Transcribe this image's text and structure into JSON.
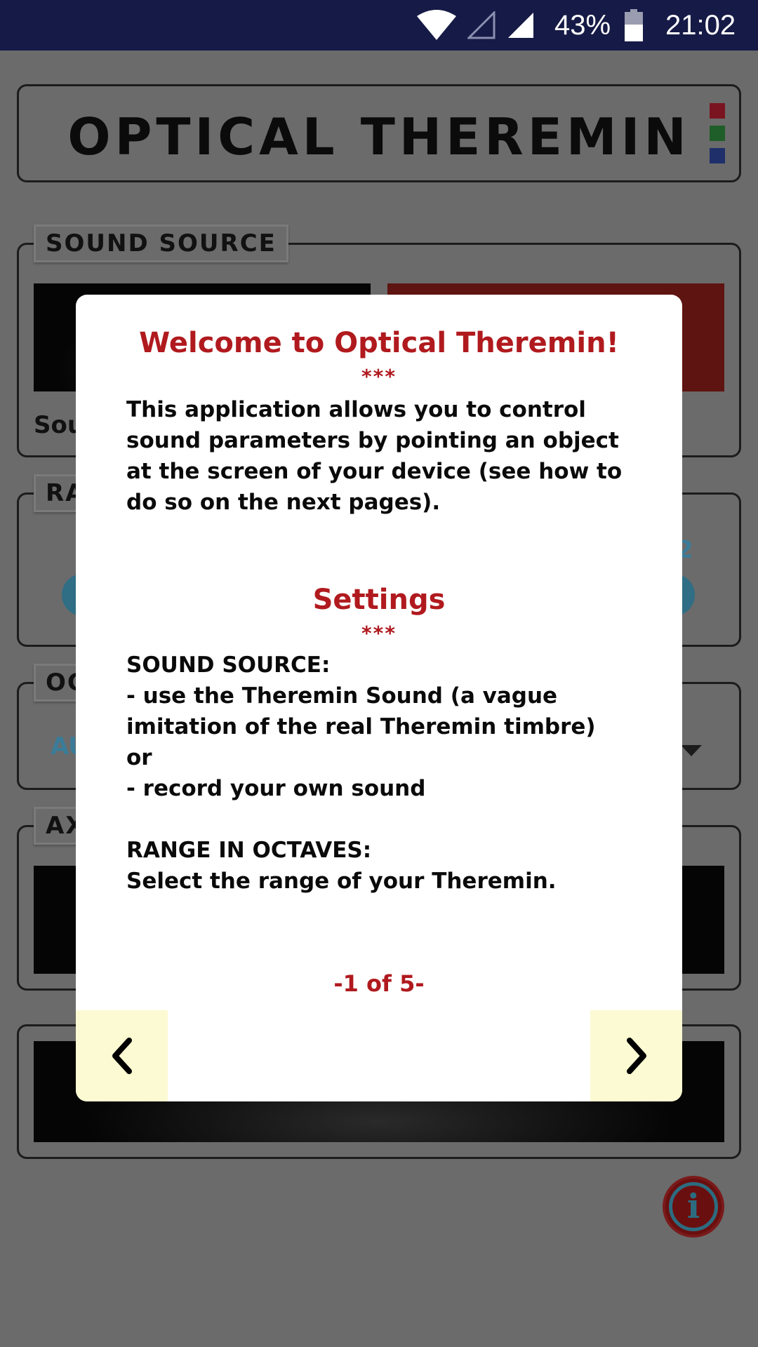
{
  "status_bar": {
    "battery": "43%",
    "time": "21:02",
    "icons": [
      "wifi-icon",
      "signal-empty-icon",
      "signal-icon",
      "battery-icon"
    ]
  },
  "app": {
    "title": "OPTICAL THEREMIN",
    "color_dots": [
      "#7a1420",
      "#1f5e28",
      "#1f2f6a"
    ],
    "sections": {
      "sound_source": "SOUND SOURCE",
      "sound_source_partial": "Sou",
      "range_partial": "RA",
      "range_right_value": "2",
      "octave_partial": "OC",
      "octave_value_partial": "AU",
      "axis_partial": "AX"
    }
  },
  "dialog": {
    "welcome_title": "Welcome to Optical Theremin!",
    "stars": "***",
    "intro_lines": [
      "This application allows you to control",
      "sound parameters by pointing an object",
      "at the screen of your device (see how to",
      "do so on the next pages)."
    ],
    "settings_title": "Settings",
    "settings_lines": [
      "SOUND SOURCE:",
      "- use the Theremin Sound (a vague",
      "imitation of the real Theremin timbre)",
      "or",
      "- record your own sound",
      "",
      "RANGE IN OCTAVES:",
      "Select the range of your Theremin."
    ],
    "pager": "-1 of 5-",
    "prev_icon": "chevron-left-icon",
    "next_icon": "chevron-right-icon"
  },
  "colors": {
    "accent_red": "#b01a1e",
    "status_bar_bg": "#161a46",
    "nav_button_bg": "#fcfad2"
  }
}
